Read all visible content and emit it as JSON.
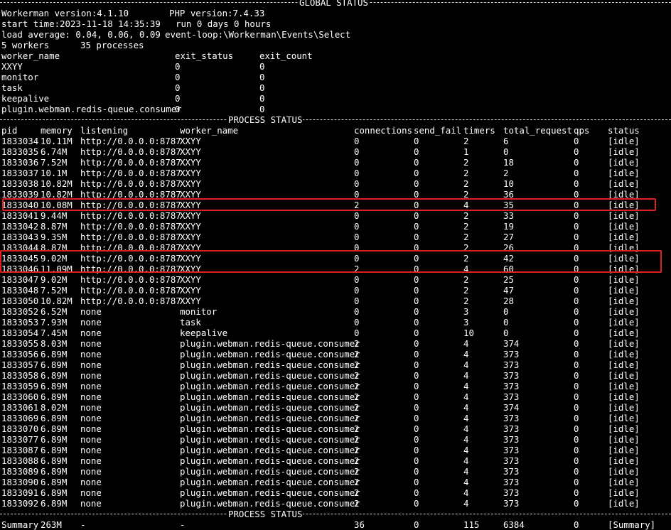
{
  "header": {
    "title_rule": "GLOBAL STATUS",
    "workerman_version": "Workerman version:4.1.10",
    "php_version": "PHP version:7.4.33",
    "start_time": "start time:2023-11-18 14:35:39",
    "run_time": "run 0 days 0 hours",
    "load_average": "load average: 0.04, 0.06, 0.09",
    "event_loop": "event-loop:\\Workerman\\Events\\Select",
    "workers": "5 workers",
    "processes": "35 processes"
  },
  "worker_table": {
    "headers": [
      "worker_name",
      "exit_status",
      "exit_count"
    ],
    "rows": [
      [
        "XXYY",
        "0",
        "0"
      ],
      [
        "monitor",
        "0",
        "0"
      ],
      [
        "task",
        "0",
        "0"
      ],
      [
        "keepalive",
        "0",
        "0"
      ],
      [
        "plugin.webman.redis-queue.consumer",
        "0",
        "0"
      ]
    ]
  },
  "process_status_rule": "PROCESS STATUS",
  "process_table": {
    "headers": [
      "pid",
      "memory",
      "listening",
      "worker_name",
      "connections",
      "send_fail",
      "timers",
      "total_request",
      "qps",
      "status"
    ],
    "rows": [
      [
        "1833034",
        "10.11M",
        "http://0.0.0.0:8787",
        "XXYY",
        "0",
        "0",
        "2",
        "6",
        "0",
        "[idle]"
      ],
      [
        "1833035",
        "6.74M",
        "http://0.0.0.0:8787",
        "XXYY",
        "0",
        "0",
        "1",
        "0",
        "0",
        "[idle]"
      ],
      [
        "1833036",
        "7.52M",
        "http://0.0.0.0:8787",
        "XXYY",
        "0",
        "0",
        "2",
        "18",
        "0",
        "[idle]"
      ],
      [
        "1833037",
        "10.1M",
        "http://0.0.0.0:8787",
        "XXYY",
        "0",
        "0",
        "2",
        "2",
        "0",
        "[idle]"
      ],
      [
        "1833038",
        "10.82M",
        "http://0.0.0.0:8787",
        "XXYY",
        "0",
        "0",
        "2",
        "10",
        "0",
        "[idle]"
      ],
      [
        "1833039",
        "10.82M",
        "http://0.0.0.0:8787",
        "XXYY",
        "0",
        "0",
        "2",
        "36",
        "0",
        "[idle]"
      ],
      [
        "1833040",
        "10.08M",
        "http://0.0.0.0:8787",
        "XXYY",
        "2",
        "0",
        "4",
        "35",
        "0",
        "[idle]"
      ],
      [
        "1833041",
        "9.44M",
        "http://0.0.0.0:8787",
        "XXYY",
        "0",
        "0",
        "2",
        "33",
        "0",
        "[idle]"
      ],
      [
        "1833042",
        "8.87M",
        "http://0.0.0.0:8787",
        "XXYY",
        "0",
        "0",
        "2",
        "19",
        "0",
        "[idle]"
      ],
      [
        "1833043",
        "9.35M",
        "http://0.0.0.0:8787",
        "XXYY",
        "0",
        "0",
        "2",
        "27",
        "0",
        "[idle]"
      ],
      [
        "1833044",
        "8.87M",
        "http://0.0.0.0:8787",
        "XXYY",
        "0",
        "0",
        "2",
        "26",
        "0",
        "[idle]"
      ],
      [
        "1833045",
        "9.02M",
        "http://0.0.0.0:8787",
        "XXYY",
        "0",
        "0",
        "2",
        "42",
        "0",
        "[idle]"
      ],
      [
        "1833046",
        "11.09M",
        "http://0.0.0.0:8787",
        "XXYY",
        "2",
        "0",
        "4",
        "60",
        "0",
        "[idle]"
      ],
      [
        "1833047",
        "9.02M",
        "http://0.0.0.0:8787",
        "XXYY",
        "0",
        "0",
        "2",
        "25",
        "0",
        "[idle]"
      ],
      [
        "1833048",
        "7.52M",
        "http://0.0.0.0:8787",
        "XXYY",
        "0",
        "0",
        "2",
        "47",
        "0",
        "[idle]"
      ],
      [
        "1833050",
        "10.82M",
        "http://0.0.0.0:8787",
        "XXYY",
        "0",
        "0",
        "2",
        "28",
        "0",
        "[idle]"
      ],
      [
        "1833052",
        "6.52M",
        "none",
        "monitor",
        "0",
        "0",
        "3",
        "0",
        "0",
        "[idle]"
      ],
      [
        "1833053",
        "7.93M",
        "none",
        "task",
        "0",
        "0",
        "3",
        "0",
        "0",
        "[idle]"
      ],
      [
        "1833054",
        "7.45M",
        "none",
        "keepalive",
        "0",
        "0",
        "10",
        "0",
        "0",
        "[idle]"
      ],
      [
        "1833055",
        "8.03M",
        "none",
        "plugin.webman.redis-queue.consumer",
        "2",
        "0",
        "4",
        "374",
        "0",
        "[idle]"
      ],
      [
        "1833056",
        "6.89M",
        "none",
        "plugin.webman.redis-queue.consumer",
        "2",
        "0",
        "4",
        "373",
        "0",
        "[idle]"
      ],
      [
        "1833057",
        "6.89M",
        "none",
        "plugin.webman.redis-queue.consumer",
        "2",
        "0",
        "4",
        "373",
        "0",
        "[idle]"
      ],
      [
        "1833058",
        "6.89M",
        "none",
        "plugin.webman.redis-queue.consumer",
        "2",
        "0",
        "4",
        "373",
        "0",
        "[idle]"
      ],
      [
        "1833059",
        "6.89M",
        "none",
        "plugin.webman.redis-queue.consumer",
        "2",
        "0",
        "4",
        "373",
        "0",
        "[idle]"
      ],
      [
        "1833060",
        "6.89M",
        "none",
        "plugin.webman.redis-queue.consumer",
        "2",
        "0",
        "4",
        "373",
        "0",
        "[idle]"
      ],
      [
        "1833061",
        "8.02M",
        "none",
        "plugin.webman.redis-queue.consumer",
        "2",
        "0",
        "4",
        "374",
        "0",
        "[idle]"
      ],
      [
        "1833069",
        "6.89M",
        "none",
        "plugin.webman.redis-queue.consumer",
        "2",
        "0",
        "4",
        "373",
        "0",
        "[idle]"
      ],
      [
        "1833070",
        "6.89M",
        "none",
        "plugin.webman.redis-queue.consumer",
        "2",
        "0",
        "4",
        "373",
        "0",
        "[idle]"
      ],
      [
        "1833077",
        "6.89M",
        "none",
        "plugin.webman.redis-queue.consumer",
        "2",
        "0",
        "4",
        "373",
        "0",
        "[idle]"
      ],
      [
        "1833087",
        "6.89M",
        "none",
        "plugin.webman.redis-queue.consumer",
        "2",
        "0",
        "4",
        "373",
        "0",
        "[idle]"
      ],
      [
        "1833088",
        "6.89M",
        "none",
        "plugin.webman.redis-queue.consumer",
        "2",
        "0",
        "4",
        "373",
        "0",
        "[idle]"
      ],
      [
        "1833089",
        "6.89M",
        "none",
        "plugin.webman.redis-queue.consumer",
        "2",
        "0",
        "4",
        "373",
        "0",
        "[idle]"
      ],
      [
        "1833090",
        "6.89M",
        "none",
        "plugin.webman.redis-queue.consumer",
        "2",
        "0",
        "4",
        "373",
        "0",
        "[idle]"
      ],
      [
        "1833091",
        "6.89M",
        "none",
        "plugin.webman.redis-queue.consumer",
        "2",
        "0",
        "4",
        "373",
        "0",
        "[idle]"
      ],
      [
        "1833092",
        "6.89M",
        "none",
        "plugin.webman.redis-queue.consumer",
        "2",
        "0",
        "4",
        "373",
        "0",
        "[idle]"
      ]
    ],
    "highlighted_pids": [
      "1833040",
      "1833046"
    ],
    "highlight_color": "#e02020"
  },
  "summary": [
    "Summary",
    "263M",
    "-",
    "-",
    "36",
    "0",
    "115",
    "6384",
    "0",
    "[Summary]"
  ],
  "colors": {
    "background": "#000000",
    "text": "#ffffff",
    "cursor": "#3ad83a"
  }
}
